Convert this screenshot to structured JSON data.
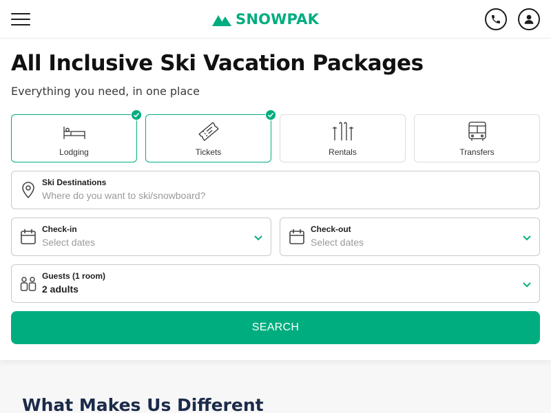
{
  "brand": {
    "name": "SNOWPAK",
    "color": "#00ad7f"
  },
  "header": {
    "menu_icon": "hamburger-menu-icon",
    "phone_icon": "phone-icon",
    "account_icon": "user-icon"
  },
  "hero": {
    "title": "All Inclusive Ski Vacation Packages",
    "subtitle": "Everything you need, in one place"
  },
  "services": [
    {
      "label": "Lodging",
      "icon": "bed-icon",
      "selected": true
    },
    {
      "label": "Tickets",
      "icon": "ticket-icon",
      "selected": true
    },
    {
      "label": "Rentals",
      "icon": "skis-poles-icon",
      "selected": false
    },
    {
      "label": "Transfers",
      "icon": "bus-icon",
      "selected": false
    }
  ],
  "destination": {
    "label": "Ski Destinations",
    "placeholder": "Where do you want to ski/snowboard?",
    "icon": "map-pin-icon"
  },
  "checkin": {
    "label": "Check-in",
    "placeholder": "Select dates",
    "icon": "calendar-icon"
  },
  "checkout": {
    "label": "Check-out",
    "placeholder": "Select dates",
    "icon": "calendar-icon"
  },
  "guests": {
    "label": "Guests (1 room)",
    "value": "2 adults",
    "icon": "people-icon"
  },
  "search_label": "SEARCH",
  "section_title": "What Makes Us Different"
}
